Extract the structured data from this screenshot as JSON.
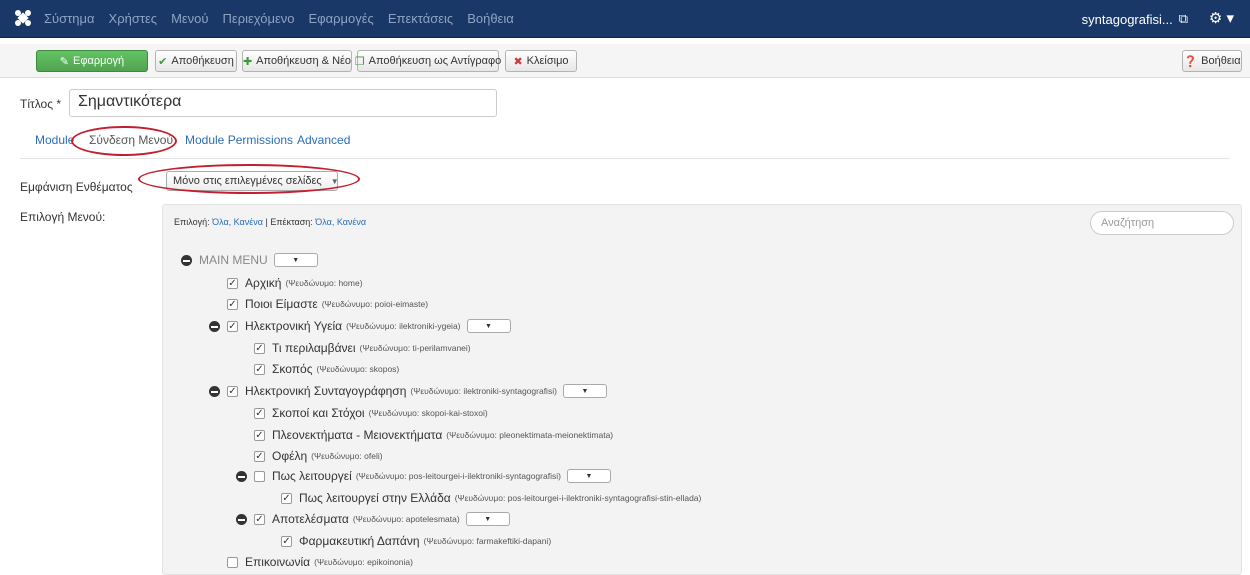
{
  "navbar": {
    "menu": [
      "Σύστημα",
      "Χρήστες",
      "Μενού",
      "Περιεχόμενο",
      "Εφαρμογές",
      "Επεκτάσεις",
      "Βοήθεια"
    ],
    "user": "syntagografisi...",
    "user_icon": "external-link-icon",
    "gear_icon": "gear-icon"
  },
  "toolbar": {
    "apply": "Εφαρμογή",
    "save": "Αποθήκευση",
    "save_new": "Αποθήκευση & Νέο",
    "save_copy": "Αποθήκευση ως Αντίγραφο",
    "close": "Κλείσιμο",
    "help": "Βοήθεια",
    "success_color": "#51a351",
    "close_icon_color": "#c83b3b"
  },
  "form": {
    "title_label": "Τίτλος *",
    "title_value": "Σημαντικότερα",
    "assign_label": "Εμφάνιση Ενθέματος",
    "assign_value": "Μόνο στις επιλεγμένες σελίδες",
    "menu_select_label": "Επιλογή Μενού:"
  },
  "tabs": [
    {
      "label": "Module"
    },
    {
      "label": "Σύνδεση Μενού"
    },
    {
      "label": "Module Permissions"
    },
    {
      "label": "Advanced"
    }
  ],
  "highlight_color": "#c2202e",
  "panel": {
    "select_prefix": "Επιλογή:",
    "select_links": "Όλα, Κανένα",
    "separator": "|",
    "expand_prefix": "Επέκταση:",
    "expand_links": "Όλα, Κανένα",
    "search_placeholder": "Αναζήτηση",
    "menu_title": "MAIN MENU"
  },
  "items": [
    {
      "name": "Αρχική",
      "alias": "(Ψευδώνυμο: home)",
      "checked": true
    },
    {
      "name": "Ποιοι Είμαστε",
      "alias": "(Ψευδώνυμο: poioi-eimaste)",
      "checked": true
    },
    {
      "name": "Ηλεκτρονική Υγεία",
      "alias": "(Ψευδώνυμο: ilektroniki-ygeia)",
      "checked": true
    },
    {
      "name": "Τι περιλαμβάνει",
      "alias": "(Ψευδώνυμο: ti-perilamvanei)",
      "checked": true
    },
    {
      "name": "Σκοπός",
      "alias": "(Ψευδώνυμο: skopos)",
      "checked": true
    },
    {
      "name": "Ηλεκτρονική Συνταγογράφηση",
      "alias": "(Ψευδώνυμο: ilektroniki-syntagografisi)",
      "checked": true
    },
    {
      "name": "Σκοποί και Στόχοι",
      "alias": "(Ψευδώνυμο: skopoi-kai-stoxoi)",
      "checked": true
    },
    {
      "name": "Πλεονεκτήματα - Μειονεκτήματα",
      "alias": "(Ψευδώνυμο: pleonektimata-meionektimata)",
      "checked": true
    },
    {
      "name": "Οφέλη",
      "alias": "(Ψευδώνυμο: ofeli)",
      "checked": true
    },
    {
      "name": "Πως λειτουργεί",
      "alias": "(Ψευδώνυμο: pos-leitourgei-i-ilektroniki-syntagografisi)",
      "checked": false
    },
    {
      "name": "Πως λειτουργεί στην Ελλάδα",
      "alias": "(Ψευδώνυμο: pos-leitourgei-i-ilektroniki-syntagografisi-stin-ellada)",
      "checked": true
    },
    {
      "name": "Αποτελέσματα",
      "alias": "(Ψευδώνυμο: apotelesmata)",
      "checked": true
    },
    {
      "name": "Φαρμακευτική Δαπάνη",
      "alias": "(Ψευδώνυμο: farmakeftiki-dapani)",
      "checked": true
    },
    {
      "name": "Επικοινωνία",
      "alias": "(Ψευδώνυμο: epikoinonia)",
      "checked": false
    }
  ]
}
